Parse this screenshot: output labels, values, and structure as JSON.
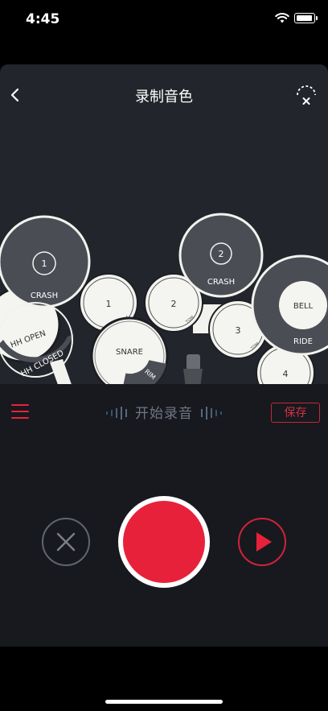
{
  "status_bar": {
    "time": "4:45"
  },
  "header": {
    "title": "录制音色"
  },
  "kit": {
    "crash_left_number": "1",
    "crash_left_label": "CRASH",
    "crash_right_number": "2",
    "crash_right_label": "CRASH",
    "hh_open_label": "HH OPEN",
    "hh_closed_label": "HH CLOSED",
    "tom1_number": "1",
    "tom2_number": "2",
    "tom3_number": "3",
    "tom4_number": "4",
    "tom_label": "TOM",
    "snare_label": "SNARE",
    "rim_label": "RIM",
    "bell_label": "BELL",
    "ride_label": "RIDE"
  },
  "controls": {
    "start_record_label": "开始录音",
    "save_label": "保存"
  },
  "colors": {
    "accent": "#e8213a",
    "panel": "#22252b",
    "background": "#17191e",
    "cymbal": "#4b4d55",
    "drum_head": "#f4f4f0"
  }
}
